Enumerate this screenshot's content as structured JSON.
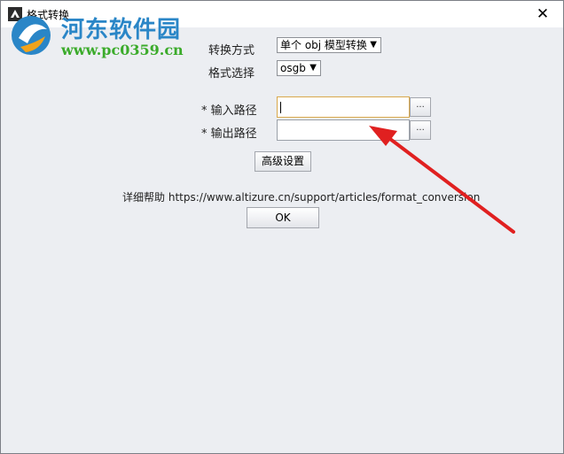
{
  "window": {
    "title": "格式转换",
    "close_glyph": "✕"
  },
  "watermark": {
    "site_name": "河东软件园",
    "url": "www.pc0359.cn"
  },
  "form": {
    "convert_mode": {
      "label": "转换方式",
      "value": "单个 obj 模型转换"
    },
    "format_select": {
      "label": "格式选择",
      "value": "osgb"
    },
    "input_path": {
      "label": "* 输入路径",
      "value": "",
      "browse_label": "..."
    },
    "output_path": {
      "label": "* 输出路径",
      "value": "",
      "browse_label": "..."
    },
    "advanced_button": "高级设置",
    "help": {
      "label": "详细帮助",
      "url": "https://www.altizure.cn/support/articles/format_conversion"
    },
    "ok_button": "OK"
  },
  "icons": {
    "app": "app-logo-icon",
    "dropdown": "chevron-down-icon",
    "close": "close-icon"
  },
  "colors": {
    "arrow": "#e02020",
    "watermark_blue": "#2a86c7",
    "watermark_green": "#3bab2b",
    "focus_border": "#d9a84b"
  }
}
